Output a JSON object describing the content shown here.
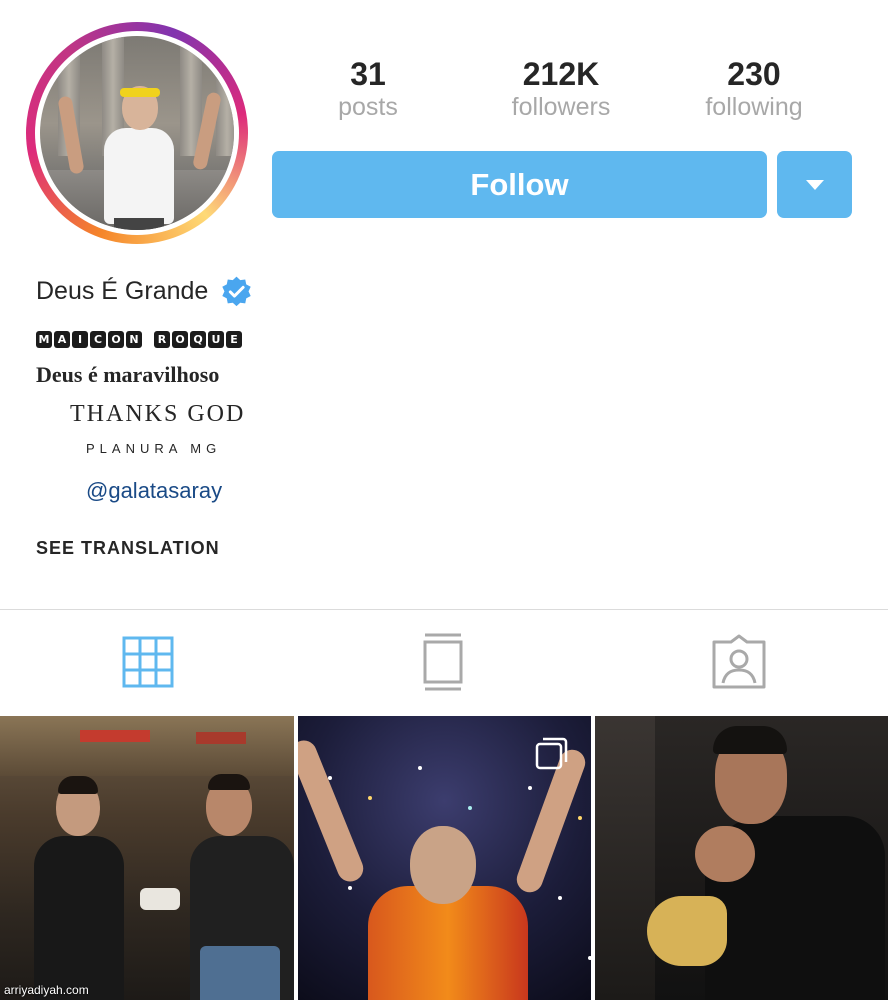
{
  "profile": {
    "display_name": "Deus É Grande",
    "verified": true
  },
  "stats": [
    {
      "count": "31",
      "label": "posts"
    },
    {
      "count": "212K",
      "label": "followers"
    },
    {
      "count": "230",
      "label": "following"
    }
  ],
  "actions": {
    "follow_label": "Follow",
    "dropdown_icon": "caret-down-icon"
  },
  "bio": {
    "stylized_words": [
      [
        "M",
        "A",
        "I",
        "C",
        "O",
        "N"
      ],
      [
        "R",
        "O",
        "Q",
        "U",
        "E"
      ]
    ],
    "line1": "Deus é maravilhoso",
    "line2": "THANKS GOD",
    "line3": "PLANURA MG",
    "mention": "@galatasaray",
    "see_translation": "SEE TRANSLATION"
  },
  "tabs": [
    {
      "name": "grid-icon",
      "active": true
    },
    {
      "name": "feed-icon",
      "active": false
    },
    {
      "name": "tagged-icon",
      "active": false
    }
  ],
  "watermark": "arriyadiyah.com",
  "colors": {
    "accent": "#5fb8ef",
    "active_tab": "#5fb8ef",
    "inactive_tab": "#a9a9a9",
    "link": "#1a4a86"
  }
}
